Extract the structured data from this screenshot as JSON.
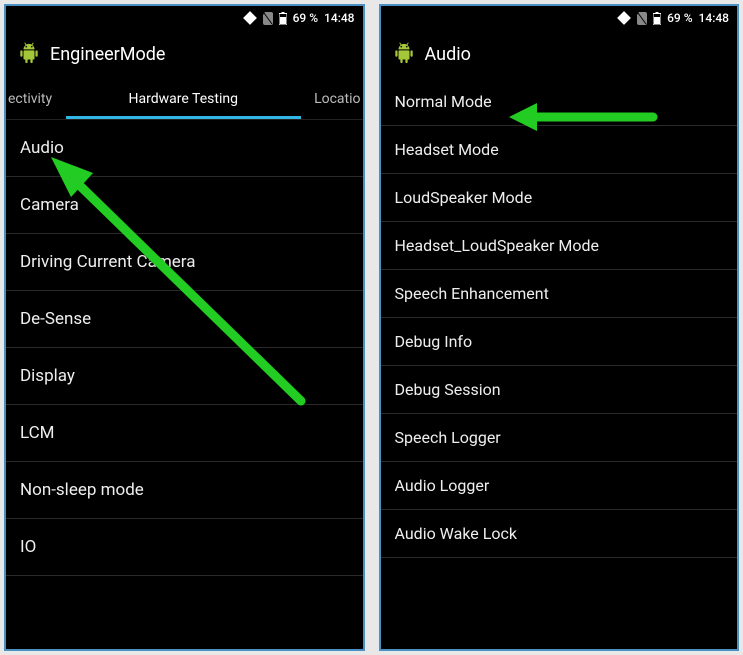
{
  "status": {
    "battery": "69 %",
    "time": "14:48"
  },
  "left": {
    "title": "EngineerMode",
    "tabs": {
      "prev": "ectivity",
      "active": "Hardware Testing",
      "next": "Locatio"
    },
    "items": [
      "Audio",
      "Camera",
      "Driving Current Camera",
      "De-Sense",
      "Display",
      "LCM",
      "Non-sleep mode",
      "IO"
    ]
  },
  "right": {
    "title": "Audio",
    "items": [
      "Normal Mode",
      "Headset Mode",
      "LoudSpeaker Mode",
      "Headset_LoudSpeaker Mode",
      "Speech Enhancement",
      "Debug Info",
      "Debug Session",
      "Speech Logger",
      "Audio Logger",
      "Audio Wake Lock"
    ]
  }
}
